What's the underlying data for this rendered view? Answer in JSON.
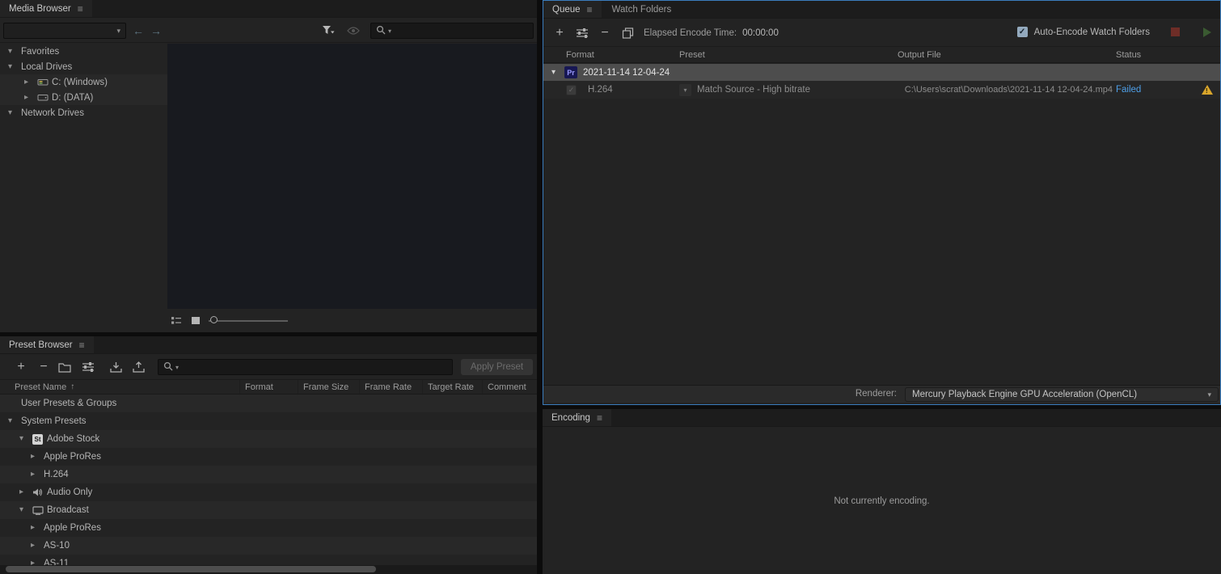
{
  "colors": {
    "focus_border_blue": "#3a7cbd",
    "status_failed_blue": "#4e9fe8",
    "warning_yellow": "#d9a62b",
    "premiere_badge_bg": "#171753",
    "premiere_badge_text": "#9a9aff",
    "selected_row_gray": "#4d4d4d"
  },
  "media_browser": {
    "title": "Media Browser",
    "location_dropdown_value": "",
    "search_value": "",
    "tree": [
      {
        "label": "Favorites"
      },
      {
        "label": "Local Drives"
      },
      {
        "label": "C: (Windows)"
      },
      {
        "label": "D: (DATA)"
      },
      {
        "label": "Network Drives"
      }
    ]
  },
  "preset_browser": {
    "title": "Preset Browser",
    "search_value": "",
    "apply_preset_label": "Apply Preset",
    "columns": {
      "name": "Preset Name",
      "format": "Format",
      "frame_size": "Frame Size",
      "frame_rate": "Frame Rate",
      "target_rate": "Target Rate",
      "comment": "Comment"
    },
    "rows": [
      {
        "label": "User Presets & Groups"
      },
      {
        "label": "System Presets"
      },
      {
        "label": "Adobe Stock",
        "badge": "St"
      },
      {
        "label": "Apple ProRes"
      },
      {
        "label": "H.264"
      },
      {
        "label": "Audio Only"
      },
      {
        "label": "Broadcast"
      },
      {
        "label": "Apple ProRes"
      },
      {
        "label": "AS-10"
      },
      {
        "label": "AS-11"
      }
    ]
  },
  "queue": {
    "tabs": [
      {
        "label": "Queue"
      },
      {
        "label": "Watch Folders"
      }
    ],
    "toolbar": {
      "elapsed_label": "Elapsed Encode Time:",
      "elapsed_value": "00:00:00",
      "auto_encode_label": "Auto-Encode Watch Folders",
      "auto_encode_checked": true
    },
    "columns": {
      "format": "Format",
      "preset": "Preset",
      "output_file": "Output File",
      "status": "Status"
    },
    "group_row": {
      "badge": "Pr",
      "name": "2021-11-14 12-04-24"
    },
    "job_row": {
      "format": "H.264",
      "preset": "Match Source - High bitrate",
      "output_file": "C:\\Users\\scrat\\Downloads\\2021-11-14 12-04-24.mp4",
      "status": "Failed"
    },
    "renderer": {
      "label": "Renderer:",
      "value": "Mercury Playback Engine GPU Acceleration (OpenCL)"
    }
  },
  "encoding": {
    "title": "Encoding",
    "message": "Not currently encoding."
  }
}
